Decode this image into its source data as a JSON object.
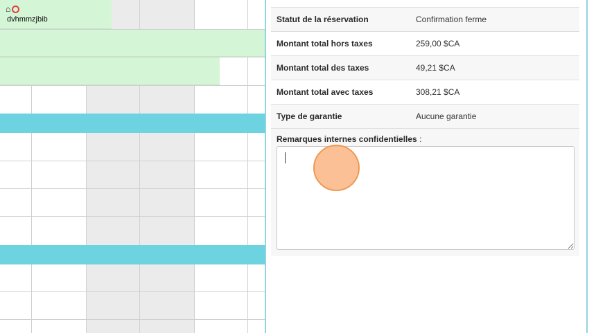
{
  "calendar": {
    "booking": {
      "name": "dvhmmzjbib",
      "icons": [
        "house-icon",
        "circle-icon"
      ],
      "color": "#d4f5d6"
    },
    "band_color": "#6dd3e0"
  },
  "details": {
    "rows": [
      {
        "label": "Statut de la réservation",
        "value": "Confirmation ferme"
      },
      {
        "label": "Montant total hors taxes",
        "value": "259,00 $CA"
      },
      {
        "label": "Montant total des taxes",
        "value": "49,21 $CA"
      },
      {
        "label": "Montant total avec taxes",
        "value": "308,21 $CA"
      },
      {
        "label": "Type de garantie",
        "value": "Aucune garantie"
      }
    ],
    "remarks": {
      "label": "Remarques internes confidentielles",
      "suffix": " :",
      "value": ""
    }
  }
}
